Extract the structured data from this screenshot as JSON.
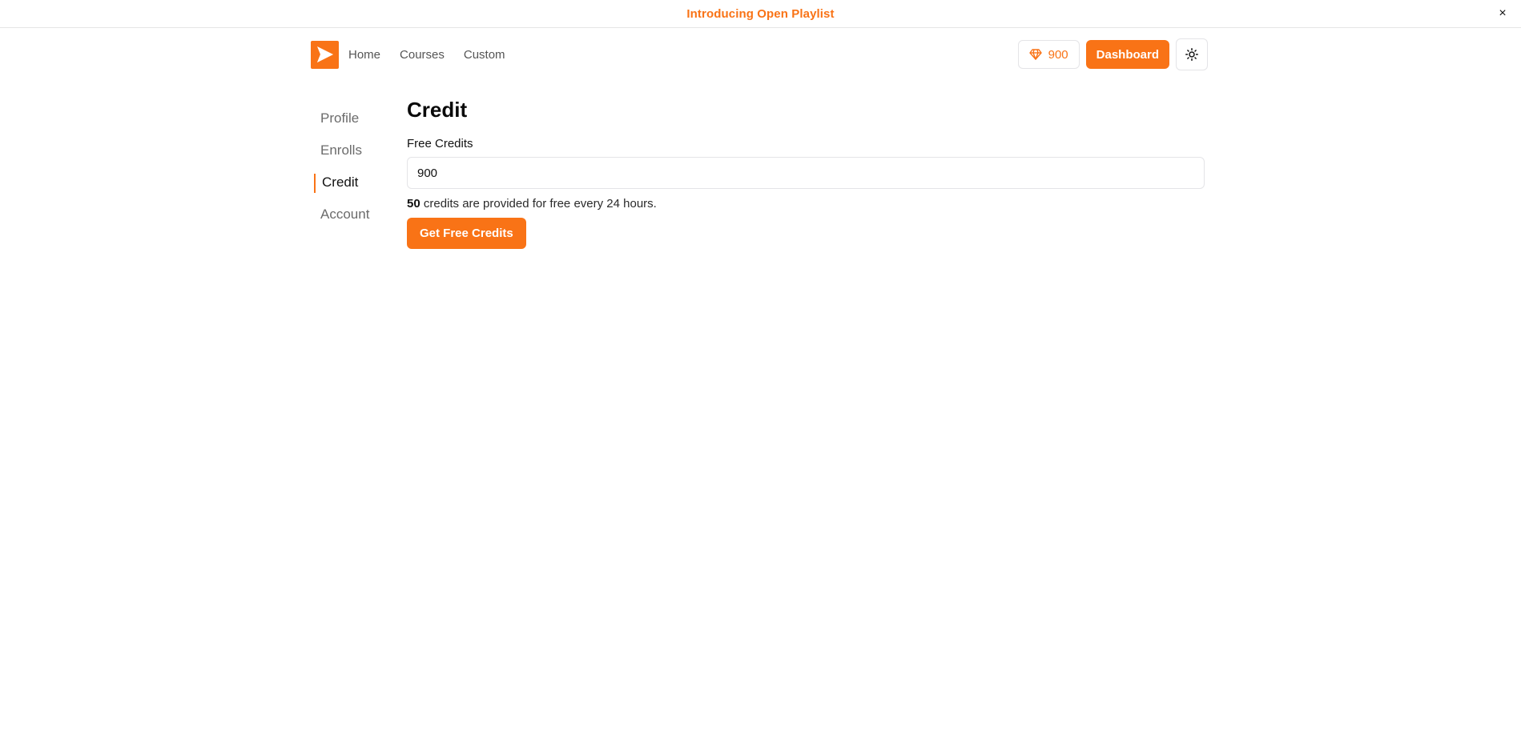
{
  "banner": {
    "text": "Introducing Open Playlist",
    "close_glyph": "×"
  },
  "header": {
    "logo_icon": "play-logo-icon",
    "nav": [
      {
        "label": "Home"
      },
      {
        "label": "Courses"
      },
      {
        "label": "Custom"
      }
    ],
    "credits": {
      "icon": "gem-icon",
      "value": "900"
    },
    "dashboard_label": "Dashboard",
    "theme_icon": "sun-icon"
  },
  "sidebar": {
    "items": [
      {
        "label": "Profile",
        "active": false
      },
      {
        "label": "Enrolls",
        "active": false
      },
      {
        "label": "Credit",
        "active": true
      },
      {
        "label": "Account",
        "active": false
      }
    ]
  },
  "main": {
    "title": "Credit",
    "field_label": "Free Credits",
    "field_value": "900",
    "helper_amount": "50",
    "helper_text": " credits are provided for free every 24 hours.",
    "button_label": "Get Free Credits"
  },
  "colors": {
    "accent": "#f97316",
    "border": "#e4e4e7",
    "muted_text": "#6b6b6b"
  }
}
